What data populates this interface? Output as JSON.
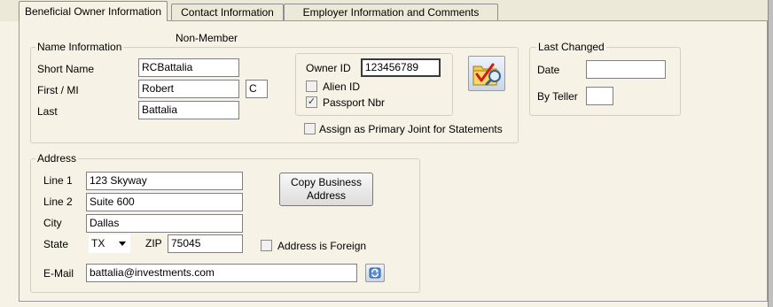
{
  "tabs": [
    {
      "label": "Beneficial Owner Information"
    },
    {
      "label": "Contact Information"
    },
    {
      "label": "Employer Information and Comments"
    }
  ],
  "member_status": "Non-Member",
  "name_info": {
    "legend": "Name Information",
    "short_name_label": "Short Name",
    "short_name_value": "RCBattalia",
    "first_mi_label": "First / MI",
    "first_value": "Robert",
    "mi_value": "C",
    "last_label": "Last",
    "last_value": "Battalia",
    "owner_id_label": "Owner ID",
    "owner_id_value": "123456789",
    "alien_id_label": "Alien ID",
    "alien_id_checked": false,
    "passport_label": "Passport Nbr",
    "passport_checked": true,
    "primary_joint_label": "Assign as Primary Joint for Statements",
    "primary_joint_checked": false,
    "lookup_icon": "folder-check-magnifier-icon"
  },
  "last_changed": {
    "legend": "Last Changed",
    "date_label": "Date",
    "date_value": "",
    "teller_label": "By Teller",
    "teller_value": ""
  },
  "address": {
    "legend": "Address",
    "line1_label": "Line 1",
    "line1_value": "123 Skyway",
    "line2_label": "Line 2",
    "line2_value": "Suite 600",
    "city_label": "City",
    "city_value": "Dallas",
    "state_label": "State",
    "state_value": "TX",
    "zip_label": "ZIP",
    "zip_value": "75045",
    "foreign_label": "Address is Foreign",
    "foreign_checked": false,
    "email_label": "E-Mail",
    "email_value": "battalia@investments.com",
    "copy_button_line1": "Copy Business",
    "copy_button_line2": "Address",
    "email_icon": "refresh-arrows-icon"
  }
}
